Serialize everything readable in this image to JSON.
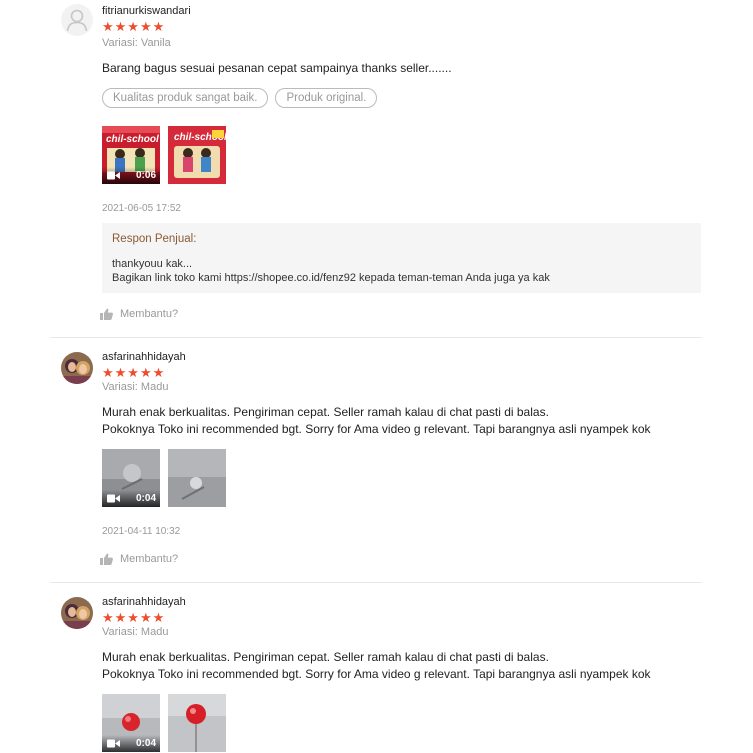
{
  "reviews": [
    {
      "username": "fitrianurkiswandari",
      "stars": "★★★★★",
      "variant": "Variasi: Vanila",
      "text_lines": [
        "Barang bagus sesuai pesanan cepat sampainya  thanks seller......."
      ],
      "tags": [
        "Kualitas produk sangat baik.",
        "Produk original."
      ],
      "video_duration": "0:06",
      "timestamp": "2021-06-05 17:52",
      "seller_reply": {
        "title": "Respon Penjual:",
        "body": "thankyouu kak...\nBagikan link toko kami https://shopee.co.id/fenz92 kepada teman-teman Anda juga ya kak"
      },
      "helpful_label": "Membantu?"
    },
    {
      "username": "asfarinahhidayah",
      "stars": "★★★★★",
      "variant": "Variasi: Madu",
      "text_lines": [
        "Murah enak berkualitas. Pengiriman cepat. Seller ramah kalau di chat pasti di balas.",
        "Pokoknya Toko ini recommended bgt. Sorry for Ama video g relevant. Tapi barangnya asli nyampek kok"
      ],
      "video_duration": "0:04",
      "timestamp": "2021-04-11 10:32",
      "helpful_label": "Membantu?"
    },
    {
      "username": "asfarinahhidayah",
      "stars": "★★★★★",
      "variant": "Variasi: Madu",
      "text_lines": [
        "Murah enak berkualitas. Pengiriman cepat. Seller ramah kalau di chat pasti di balas.",
        "Pokoknya Toko ini recommended bgt. Sorry for Ama video g relevant. Tapi barangnya asli nyampek kok"
      ],
      "video_duration": "0:04"
    }
  ],
  "colors": {
    "star": "#ee4d2d",
    "reply_title": "#8a5a33",
    "muted": "#999999"
  },
  "icons": [
    "user-avatar-icon",
    "star-icon",
    "video-camera-icon",
    "thumbs-up-icon"
  ]
}
